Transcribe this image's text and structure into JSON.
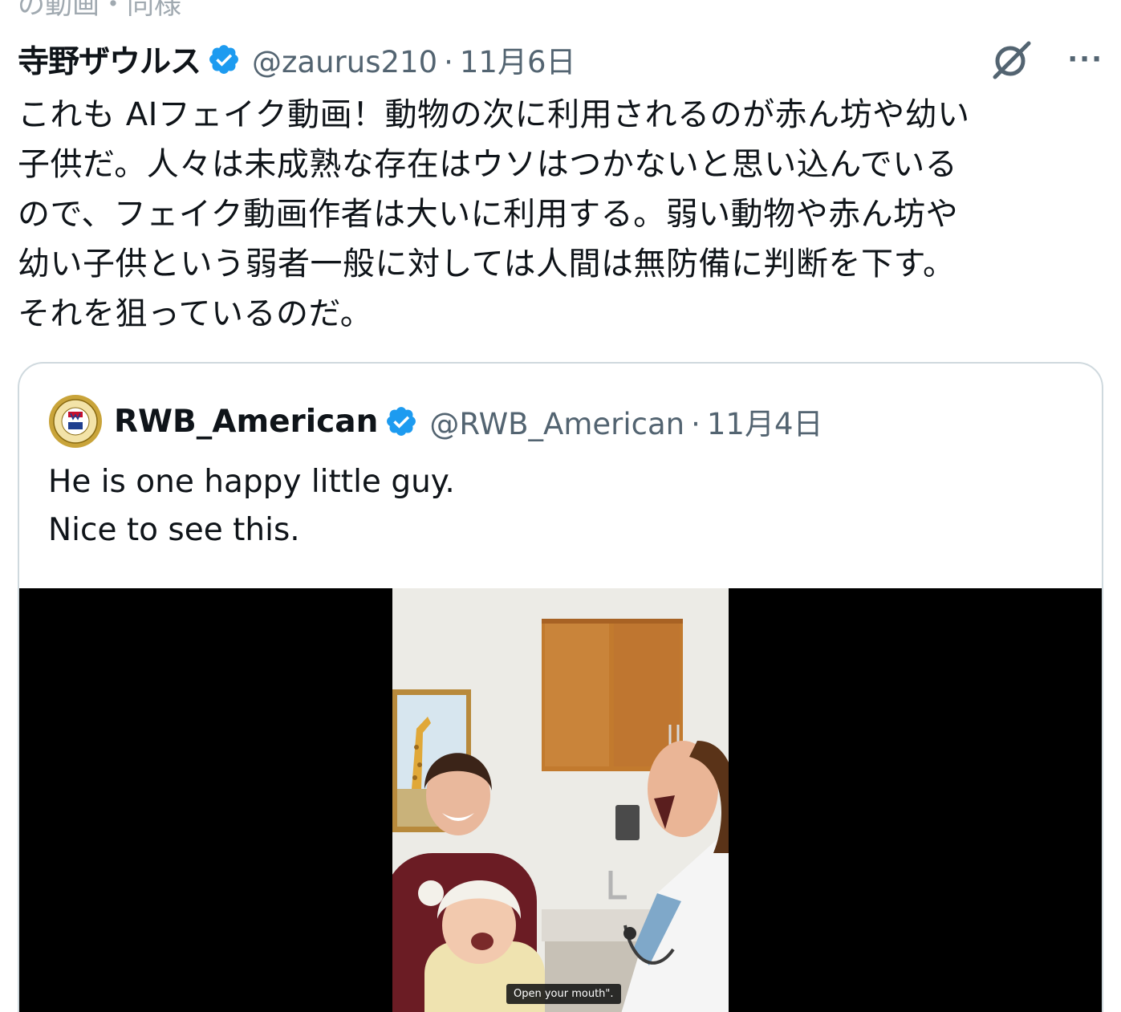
{
  "top_remnant": "の動画・同様",
  "tweet": {
    "author_name": "寺野ザウルス",
    "handle": "@zaurus210",
    "separator": "·",
    "date": "11月6日",
    "more_label": "···",
    "text": "これも AIフェイク動画！動物の次に利用されるのが赤ん坊や幼い\n子供だ。人々は未成熟な存在はウソはつかないと思い込んでいる\nので、フェイク動画作者は大いに利用する。弱い動物や赤ん坊や\n幼い子供という弱者一般に対しては人間は無防備に判断を下す。\nそれを狙っているのだ。"
  },
  "quote": {
    "author_name": "RWB_American",
    "handle": "@RWB_American",
    "separator": "·",
    "date": "11月4日",
    "text": "He is one happy little guy.\nNice to see this.",
    "video_subtitle": "Open your mouth\"."
  },
  "colors": {
    "verified_blue": "#1d9bf0",
    "secondary_text": "#536471",
    "border": "#cfd9de"
  },
  "icons": [
    "verified-badge-icon",
    "grok-icon",
    "more-options-icon",
    "avatar-logo"
  ]
}
